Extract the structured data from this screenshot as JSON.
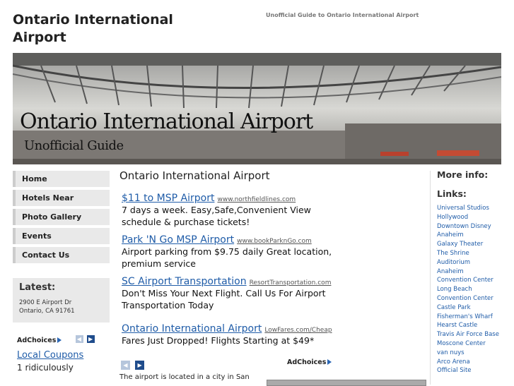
{
  "site": {
    "title": "Ontario International Airport",
    "tagline": "Unofficial Guide to Ontario International Airport"
  },
  "banner": {
    "title": "Ontario International Airport",
    "subtitle": "Unofficial Guide"
  },
  "nav": {
    "items": [
      {
        "label": "Home"
      },
      {
        "label": "Hotels Near"
      },
      {
        "label": "Photo Gallery"
      },
      {
        "label": "Events"
      },
      {
        "label": "Contact Us"
      }
    ]
  },
  "latest": {
    "title": "Latest:",
    "address_line1": "2900 E Airport Dr",
    "address_line2": "Ontario, CA 91761"
  },
  "left_ad": {
    "adchoices": "AdChoices",
    "link": "Local Coupons",
    "text": "1 ridiculously"
  },
  "main": {
    "heading": "Ontario International Airport",
    "ads": [
      {
        "link": "$11 to MSP Airport",
        "url": "www.northfieldlines.com",
        "text": "7 days a week. Easy,Safe,Convenient View schedule & purchase tickets!"
      },
      {
        "link": "Park 'N Go MSP Airport",
        "url": "www.bookParknGo.com",
        "text": "Airport parking from $9.75 daily Great location, premium service"
      },
      {
        "link": "SC Airport Transportation",
        "url": "ResortTransportation.com",
        "text": "Don't Miss Your Next Flight. Call Us For Airport Transportation Today"
      },
      {
        "link": "Ontario International Airport",
        "url": "LowFares.com/Cheap",
        "text": "Fares Just Dropped! Flights Starting at $49*"
      }
    ],
    "adchoices": "AdChoices",
    "body_text": "The airport is located in a city in San"
  },
  "sidebar": {
    "more_info": "More info:",
    "links_heading": "Links:",
    "links": [
      "Universal Studios",
      "Hollywood",
      "Downtown Disney",
      "Anaheim",
      "Galaxy Theater",
      "The Shrine",
      "Auditorium",
      "Anaheim",
      "Convention Center",
      "Long Beach",
      "Convention Center",
      "Castle Park",
      "Fisherman's Wharf",
      "Hearst Castle",
      "Travis Air Force Base",
      "Moscone Center",
      "van nuys",
      "Arco Arena",
      "Official Site"
    ]
  },
  "colors": {
    "link": "#1f5ca8",
    "nav_bg": "#e9e9e9",
    "arrow_active": "#1f4c8c"
  }
}
